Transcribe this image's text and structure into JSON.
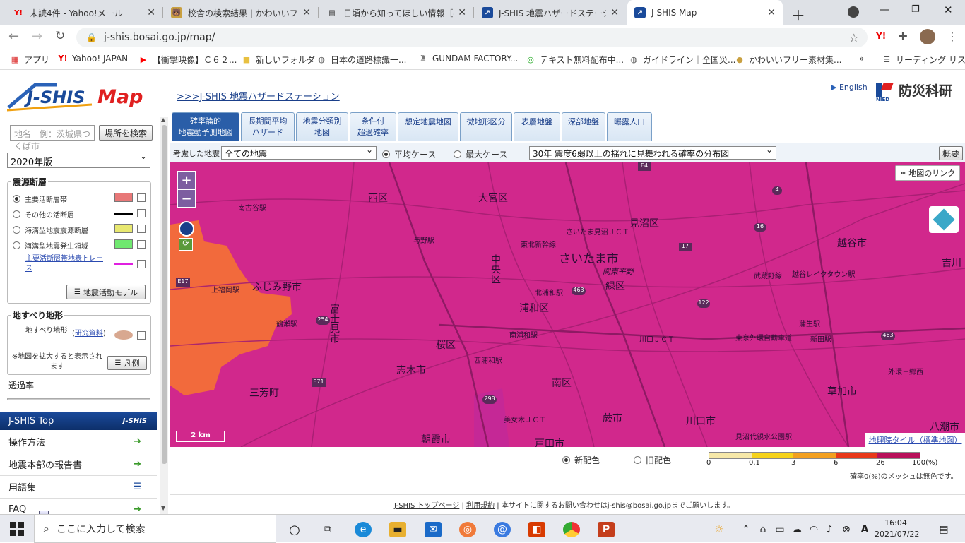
{
  "browser": {
    "tabs": [
      {
        "title": "未読4件 - Yahoo!メール",
        "icon": "Y!"
      },
      {
        "title": "校舎の検索結果 | かわいいフリー素材集",
        "icon": "🐻"
      },
      {
        "title": "日頃から知ってほしい情報［被害想定",
        "icon": "▤"
      },
      {
        "title": "J-SHIS 地震ハザードステーション",
        "icon": "↗"
      },
      {
        "title": "J-SHIS Map",
        "icon": "↗"
      }
    ],
    "url": "j-shis.bosai.go.jp/map/",
    "bookmarks": [
      "アプリ",
      "Yahoo! JAPAN",
      "【衝撃映像】Ｃ６２...",
      "新しいフォルダ",
      "日本の道路標識一...",
      "GUNDAM FACTORY...",
      "テキスト無料配布中...",
      "ガイドライン｜全国災...",
      "かわいいフリー素材集...",
      "»",
      "リーディング リスト"
    ]
  },
  "header": {
    "logo_text": "J-SHIS Map",
    "site_link": ">>>J-SHIS 地震ハザードステーション",
    "english": "English",
    "nied": "防災科研",
    "nied_small": "NIED"
  },
  "left": {
    "place_placeholder": "地名　例：茨城県つくば市",
    "search_btn": "場所を検索",
    "version": "2020年版",
    "faults_title": "震源断層",
    "faults": [
      {
        "label": "主要活断層帯",
        "color": "#e87878",
        "selected": true
      },
      {
        "label": "その他の活断層",
        "color": "#000000",
        "selected": false
      },
      {
        "label": "海溝型地震震源断層",
        "color": "#e8e870",
        "selected": false
      },
      {
        "label": "海溝型地震発生領域",
        "color": "#70e870",
        "selected": false
      }
    ],
    "trace_link": "主要活断層帯地表トレース",
    "trace_color": "#e020e0",
    "model_btn": "地震活動モデル",
    "landslide_title": "地すべり地形",
    "landslide_label": "地すべり地形",
    "landslide_link": "研究資料",
    "landslide_color": "#d8a890",
    "zoom_note": "※地図を拡大すると表示されます",
    "legend_btn": "凡例",
    "opacity_label": "透過率",
    "opacity_value": 0.22,
    "menu_header": "J-SHIS Top",
    "menu_logo": "J-SHIS",
    "menu": [
      "操作方法",
      "地震本部の報告書",
      "用語集",
      "FAQ"
    ]
  },
  "tabs": [
    {
      "l1": "確率論的",
      "l2": "地震動予測地図",
      "active": true
    },
    {
      "l1": "長期間平均",
      "l2": "ハザード"
    },
    {
      "l1": "地震分類別",
      "l2": "地図"
    },
    {
      "l1": "条件付",
      "l2": "超過確率"
    },
    {
      "l1": "想定地震地図",
      "l2": ""
    },
    {
      "l1": "微地形区分",
      "l2": ""
    },
    {
      "l1": "表層地盤",
      "l2": ""
    },
    {
      "l1": "深部地盤",
      "l2": ""
    },
    {
      "l1": "曝露人口",
      "l2": ""
    }
  ],
  "toolbar": {
    "considered_label": "考慮した地震",
    "considered_value": "全ての地震",
    "case_average": "平均ケース",
    "case_max": "最大ケース",
    "map_select": "30年 震度6弱以上の揺れに見舞われる確率の分布図",
    "summary_btn": "概要"
  },
  "map": {
    "link_btn": "地図のリンク",
    "zoom_in": "+",
    "zoom_out": "−",
    "scale": "2 km",
    "tile_link": "地理院タイル（標準地図）",
    "place_labels": [
      "西区",
      "大宮区",
      "さいたま市",
      "見沼区",
      "中央区",
      "緑区",
      "浦和区",
      "越谷市",
      "吉川",
      "越谷レイクタウン駅",
      "武蔵野線",
      "富士見市",
      "ふじみ野市",
      "桜区",
      "志木市",
      "南区",
      "朝霞市",
      "蕨市",
      "戸田市",
      "川口市",
      "草加市",
      "三芳町",
      "八潮市",
      "南古谷駅",
      "与野駅",
      "北浦和駅",
      "西浦和駅",
      "南浦和駅",
      "東京外環自動車道",
      "新田駅",
      "関東平野",
      "東北新幹線",
      "上福岡駅",
      "外環三郷西",
      "さいたま見沼ＪＣＴ",
      "鶴瀬駅",
      "美女木ＪＣＴ",
      "川口ＪＣＴ",
      "蒲生駅",
      "見沼代親水公園駅"
    ],
    "road_shields": [
      "E4",
      "4",
      "16",
      "17",
      "463",
      "298",
      "E17",
      "E71",
      "254",
      "122",
      "463"
    ]
  },
  "legend": {
    "new_color": "新配色",
    "old_color": "旧配色",
    "ticks": [
      "0",
      "0.1",
      "3",
      "6",
      "26",
      "100(%)"
    ],
    "colors": [
      "#f6e8a8",
      "#f5d21a",
      "#f2a020",
      "#e8381a",
      "#b8105a"
    ],
    "note": "確率0(%)のメッシュは無色です。"
  },
  "footer": {
    "top_link": "J-SHIS トップページ",
    "terms_link": "利用規約",
    "contact": "本サイトに関するお問い合わせはj-shis@bosai.go.jpまでご願いします。"
  },
  "taskbar": {
    "search": "ここに入力して検索",
    "time": "16:04",
    "date": "2021/07/22"
  }
}
